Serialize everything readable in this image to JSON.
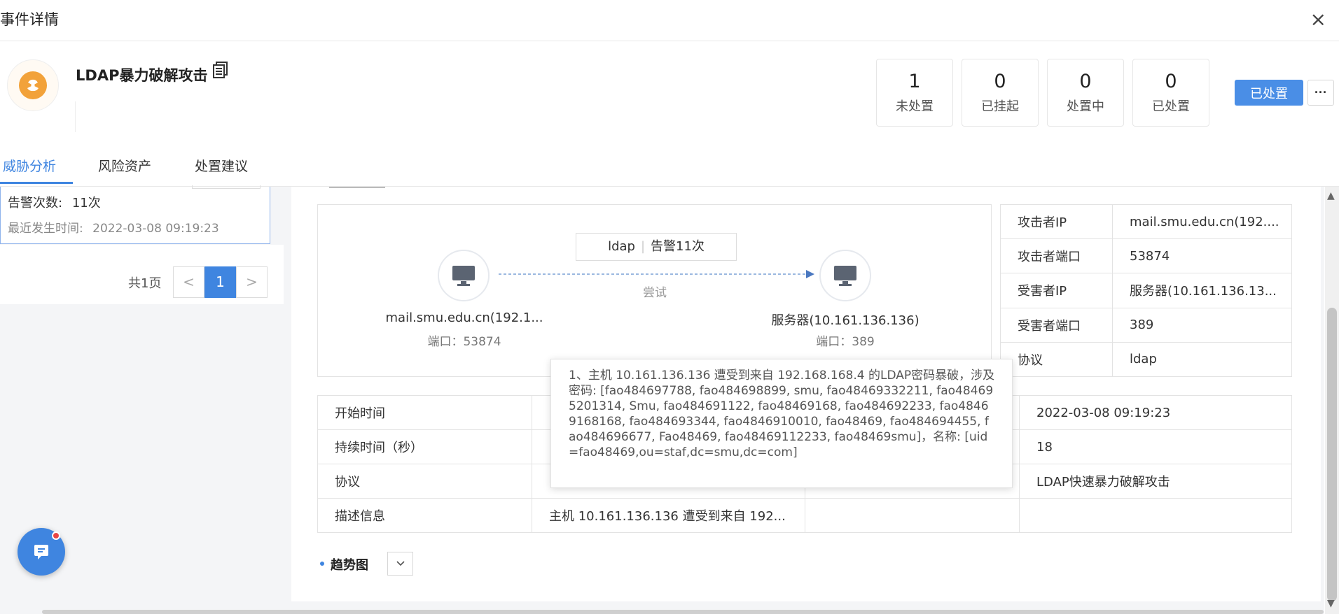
{
  "window": {
    "title": "事件详情",
    "close_glyph": "×"
  },
  "event": {
    "title": "LDAP暴力破解攻击",
    "primary_action": "已处置",
    "more_glyph": "···"
  },
  "stats": [
    {
      "value": "1",
      "label": "未处置"
    },
    {
      "value": "0",
      "label": "已挂起"
    },
    {
      "value": "0",
      "label": "处置中"
    },
    {
      "value": "0",
      "label": "已处置"
    }
  ],
  "tabs": [
    {
      "label": "威胁分析",
      "active": true
    },
    {
      "label": "风险资产",
      "active": false
    },
    {
      "label": "处置建议",
      "active": false
    }
  ],
  "alert_card": {
    "count_label": "告警次数:",
    "count_value": "11次",
    "last_time_label": "最近发生时间:",
    "last_time_value": "2022-03-08 09:19:23"
  },
  "pager": {
    "total": "共1页",
    "prev": "<",
    "current": "1",
    "next": ">"
  },
  "diagram": {
    "edge_protocol": "ldap",
    "edge_alerts": "告警11次",
    "edge_action": "尝试",
    "source": {
      "label": "mail.smu.edu.cn(192.1...",
      "port": "端口：53874"
    },
    "target": {
      "label": "服务器(10.161.136.136)",
      "port": "端口：389"
    }
  },
  "kv": [
    {
      "k": "攻击者IP",
      "v": "mail.smu.edu.cn(192...."
    },
    {
      "k": "攻击者端口",
      "v": "53874"
    },
    {
      "k": "受害者IP",
      "v": "服务器(10.161.136.13..."
    },
    {
      "k": "受害者端口",
      "v": "389"
    },
    {
      "k": "协议",
      "v": "ldap"
    }
  ],
  "details": {
    "start_label": "开始时间",
    "start_right": "2022-03-08 09:19:23",
    "duration_label": "持续时间（秒）",
    "duration_right": "18",
    "protocol_label": "协议",
    "protocol_right": "LDAP快速暴力破解攻击",
    "desc_label": "描述信息",
    "desc_value": "主机 10.161.136.136 遭受到来自 192..."
  },
  "tooltip": "1、主机 10.161.136.136 遭受到来自 192.168.168.4 的LDAP密码暴破，涉及密码: [fao484697788, fao484698899, smu, fao48469332211, fao484695201314, Smu, fao484691122, fao48469168, fao484692233, fao48469168168, fao484693344, fao4846910010, fao48469, fao484694455, fao484696677, Fao48469, fao48469112233, fao48469smu]，名称: [uid=fao48469,ou=staf,dc=smu,dc=com]",
  "trend": {
    "label": "趋势图"
  },
  "colors": {
    "accent": "#3f85e0",
    "event_icon": "#f2a23a",
    "badge": "#e84545"
  }
}
